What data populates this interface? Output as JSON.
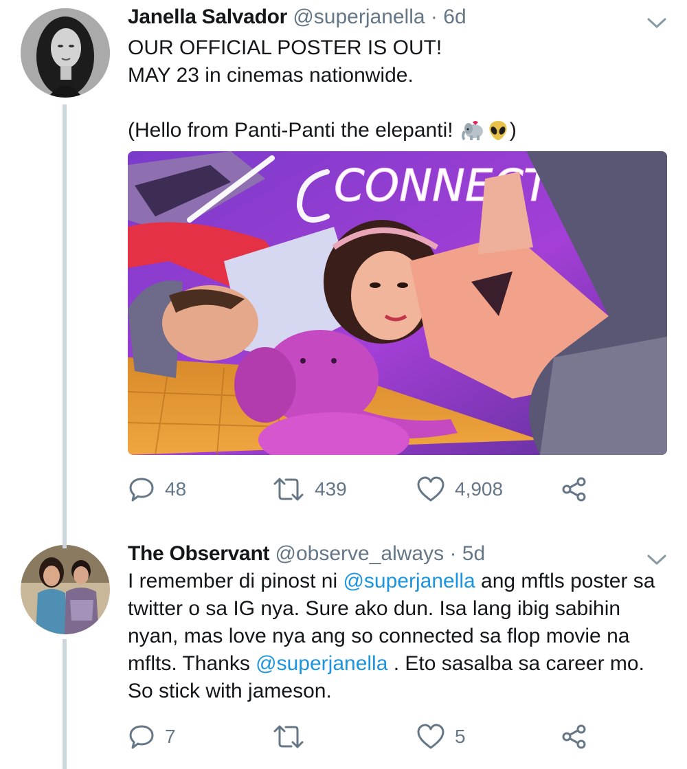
{
  "tweets": [
    {
      "author_name": "Janella Salvador",
      "handle": "@superjanella",
      "separator": "·",
      "time": "6d",
      "lines": [
        "OUR OFFICIAL POSTER IS OUT!",
        "MAY 23 in cinemas nationwide."
      ],
      "paren_text": "(Hello from Panti-Panti the elepanti! ",
      "paren_emojis": [
        "elephant-emoji",
        "alien-emoji"
      ],
      "paren_close": ")",
      "poster_text": "CONNECTE",
      "actions": {
        "reply_count": "48",
        "retweet_count": "439",
        "like_count": "4,908",
        "share_label": ""
      }
    },
    {
      "author_name": "The Observant",
      "handle": "@observe_always",
      "separator": "·",
      "time": "5d",
      "text_part1": "I remember di pinost ni ",
      "mention1": "@superjanella",
      "text_part2": " ang mftls poster sa twitter o sa IG nya. Sure ako dun. Isa lang ibig sabihin nyan, mas love nya ang so connected sa flop movie na mflts. Thanks ",
      "mention2": "@superjanella",
      "text_part3": " . Eto sasalba sa career mo. So stick with jameson.",
      "actions": {
        "reply_count": "7",
        "retweet_count": "",
        "like_count": "5",
        "share_label": ""
      }
    }
  ],
  "colors": {
    "text": "#14171a",
    "secondary": "#657786",
    "link": "#1b95e0",
    "thread_line": "#ccd6dd"
  }
}
